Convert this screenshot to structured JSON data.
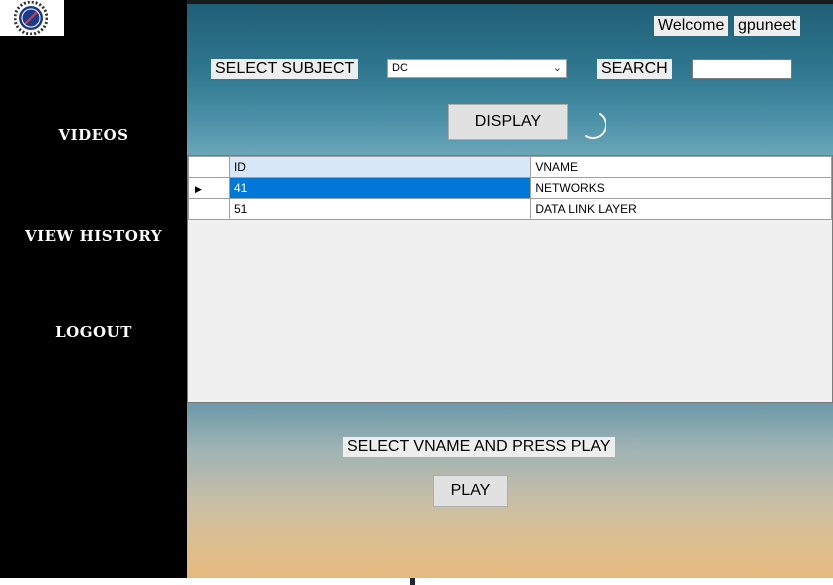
{
  "sidebar": {
    "items": [
      {
        "label": "VIDEOS"
      },
      {
        "label": "VIEW HISTORY"
      },
      {
        "label": "LOGOUT"
      }
    ]
  },
  "header": {
    "welcome_label": "Welcome",
    "username": "gpuneet",
    "select_subject_label": "SELECT SUBJECT",
    "subject_value": "DC",
    "search_label": "SEARCH",
    "search_value": "",
    "display_button": "DISPLAY"
  },
  "grid": {
    "columns": [
      "ID",
      "VNAME"
    ],
    "rows": [
      {
        "id": "41",
        "vname": "NETWORKS",
        "selected": true
      },
      {
        "id": "51",
        "vname": "DATA LINK LAYER",
        "selected": false
      }
    ]
  },
  "footer": {
    "instruction": "SELECT VNAME AND PRESS PLAY",
    "play_button": "PLAY"
  },
  "icons": {
    "logo": "gear-logo-icon",
    "row_pointer": "triangle-right-icon",
    "dropdown": "chevron-down-icon",
    "loading": "spinner-icon"
  },
  "colors": {
    "selection": "#0078d7",
    "header_cell": "#d9e8f8"
  }
}
